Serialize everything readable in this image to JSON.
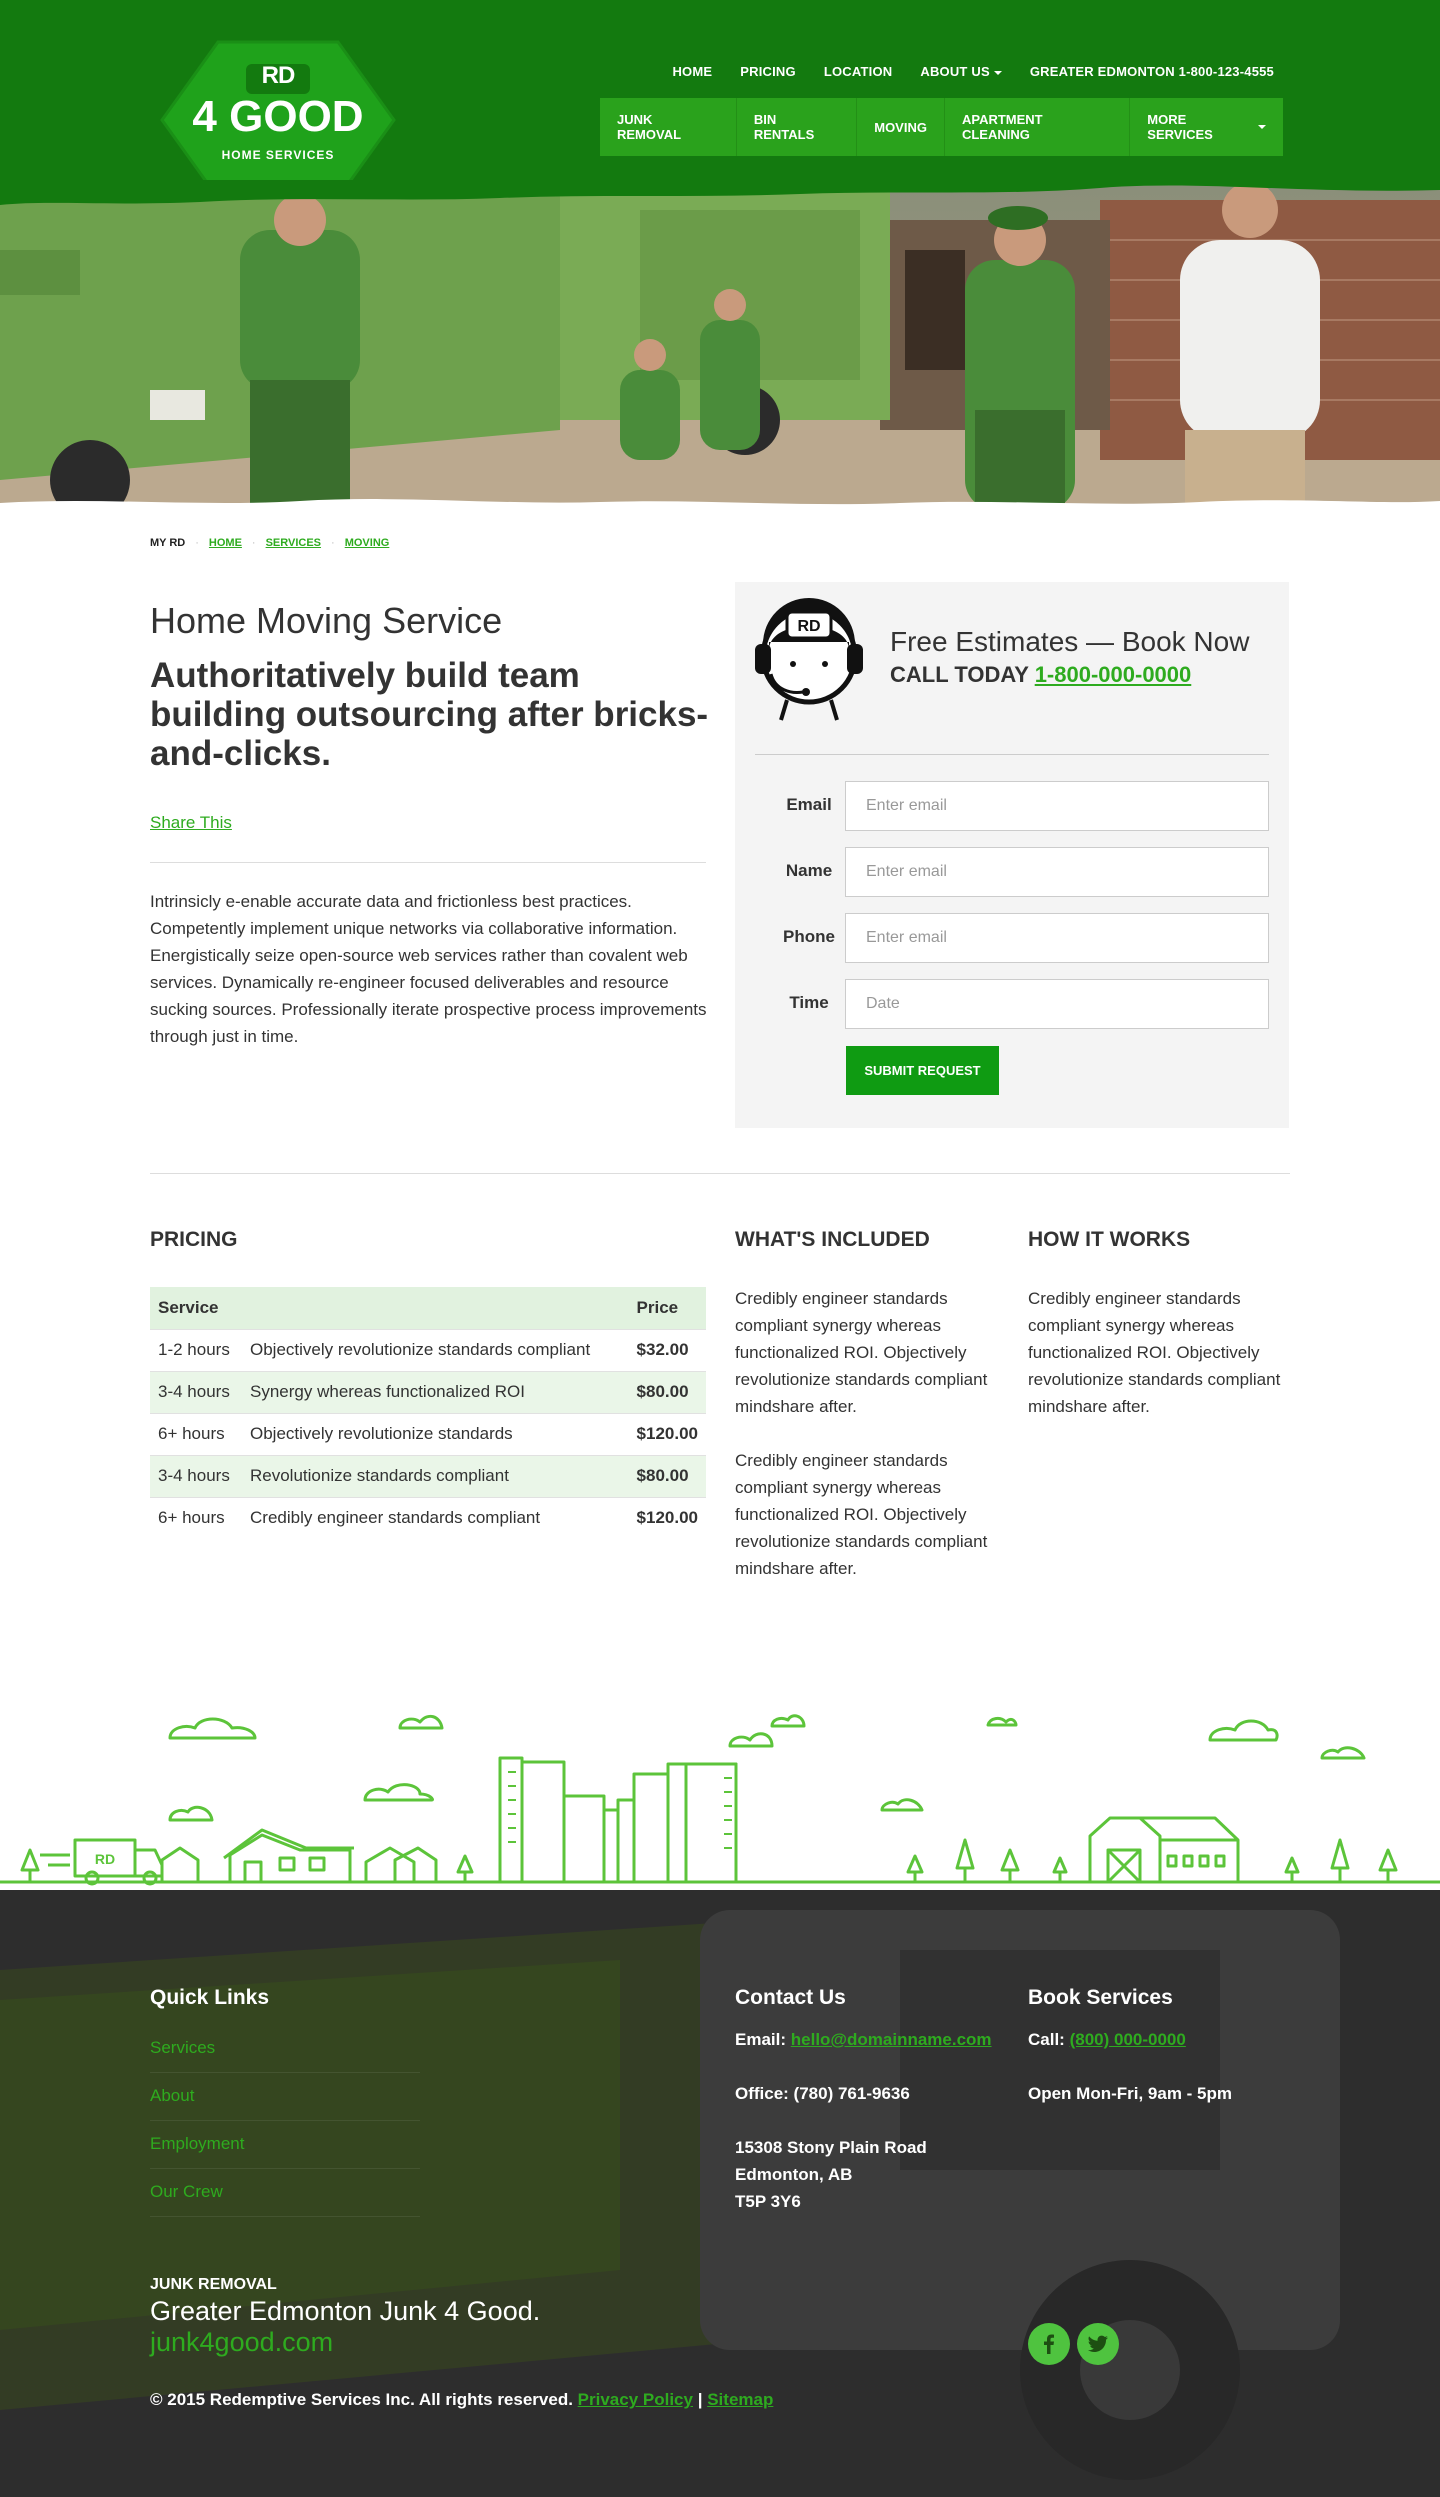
{
  "brand": {
    "logo_top": "RD",
    "logo_main": "4 GOOD",
    "logo_sub": "HOME SERVICES",
    "primary_color": "#137a0f",
    "accent_color": "#2eab1f",
    "nav_color": "#2aa21c"
  },
  "topnav": [
    {
      "label": "HOME"
    },
    {
      "label": "PRICING"
    },
    {
      "label": "LOCATION"
    },
    {
      "label": "ABOUT US",
      "dropdown": true
    },
    {
      "label": "GREATER EDMONTON 1-800-123-4555"
    }
  ],
  "mainnav": [
    {
      "label": "JUNK REMOVAL"
    },
    {
      "label": "BIN RENTALS"
    },
    {
      "label": "MOVING"
    },
    {
      "label": "APARTMENT CLEANING"
    },
    {
      "label": "MORE SERVICES",
      "dropdown": true
    }
  ],
  "breadcrumb": {
    "current": "MY RD",
    "links": [
      "HOME",
      "SERVICES",
      "MOVING"
    ]
  },
  "intro": {
    "title": "Home Moving Service",
    "lead": "Authoritatively build team building outsourcing after bricks-and-clicks.",
    "share": "Share This",
    "body": "Intrinsicly e-enable accurate data and frictionless best practices. Competently implement unique networks via collaborative information. Energistically seize open-source web services rather than covalent web services. Dynamically re-engineer focused deliverables and resource sucking sources. Professionally iterate prospective process improvements through just in time."
  },
  "estimate": {
    "title": "Free Estimates — Book Now",
    "call_prefix": "CALL TODAY",
    "phone": "1-800-000-0000",
    "agent_icon": "support-agent-icon",
    "fields": [
      {
        "label": "Email",
        "placeholder": "Enter email"
      },
      {
        "label": "Name",
        "placeholder": "Enter email"
      },
      {
        "label": "Phone",
        "placeholder": "Enter email"
      },
      {
        "label": "Time",
        "placeholder": "Date"
      }
    ],
    "submit": "SUBMIT REQUEST"
  },
  "pricing": {
    "heading": "PRICING",
    "headers": [
      "Service",
      "",
      "Price"
    ],
    "rows": [
      {
        "duration": "1-2 hours",
        "desc": "Objectively revolutionize standards compliant",
        "price": "$32.00"
      },
      {
        "duration": "3-4 hours",
        "desc": "Synergy whereas functionalized ROI",
        "price": "$80.00"
      },
      {
        "duration": "6+ hours",
        "desc": "Objectively revolutionize standards",
        "price": "$120.00"
      },
      {
        "duration": "3-4 hours",
        "desc": "Revolutionize standards compliant",
        "price": "$80.00"
      },
      {
        "duration": "6+ hours",
        "desc": "Credibly engineer standards compliant",
        "price": "$120.00"
      }
    ]
  },
  "included": {
    "heading": "WHAT'S INCLUDED",
    "p1": "Credibly engineer standards compliant synergy whereas functionalized ROI. Objectively revolutionize standards compliant mindshare after.",
    "p2": "Credibly engineer standards compliant synergy whereas functionalized ROI. Objectively revolutionize standards compliant mindshare after."
  },
  "how": {
    "heading": "HOW IT WORKS",
    "p1": "Credibly engineer standards compliant synergy whereas functionalized ROI. Objectively revolutionize standards compliant mindshare after."
  },
  "skyline": {
    "truck_label": "RD"
  },
  "footer": {
    "quick_links_heading": "Quick Links",
    "quick_links": [
      "Services",
      "About",
      "Employment",
      "Our Crew"
    ],
    "contact_heading": "Contact Us",
    "email_label": "Email:",
    "email": "hello@domainname.com",
    "office": "Office: (780) 761-9636",
    "address_1": "15308 Stony Plain Road",
    "address_2": "Edmonton, AB",
    "address_3": "T5P 3Y6",
    "book_heading": "Book Services",
    "call_label": "Call:",
    "call_phone": "(800) 000-0000",
    "hours": "Open Mon-Fri, 9am - 5pm",
    "junk_label": "JUNK REMOVAL",
    "tagline": "Greater Edmonton Junk 4 Good.",
    "site": "junk4good.com",
    "copyright": "© 2015 Redemptive Services Inc. All rights reserved.",
    "privacy": "Privacy Policy",
    "divider": "|",
    "sitemap": "Sitemap",
    "social": [
      "facebook-icon",
      "twitter-icon"
    ]
  }
}
